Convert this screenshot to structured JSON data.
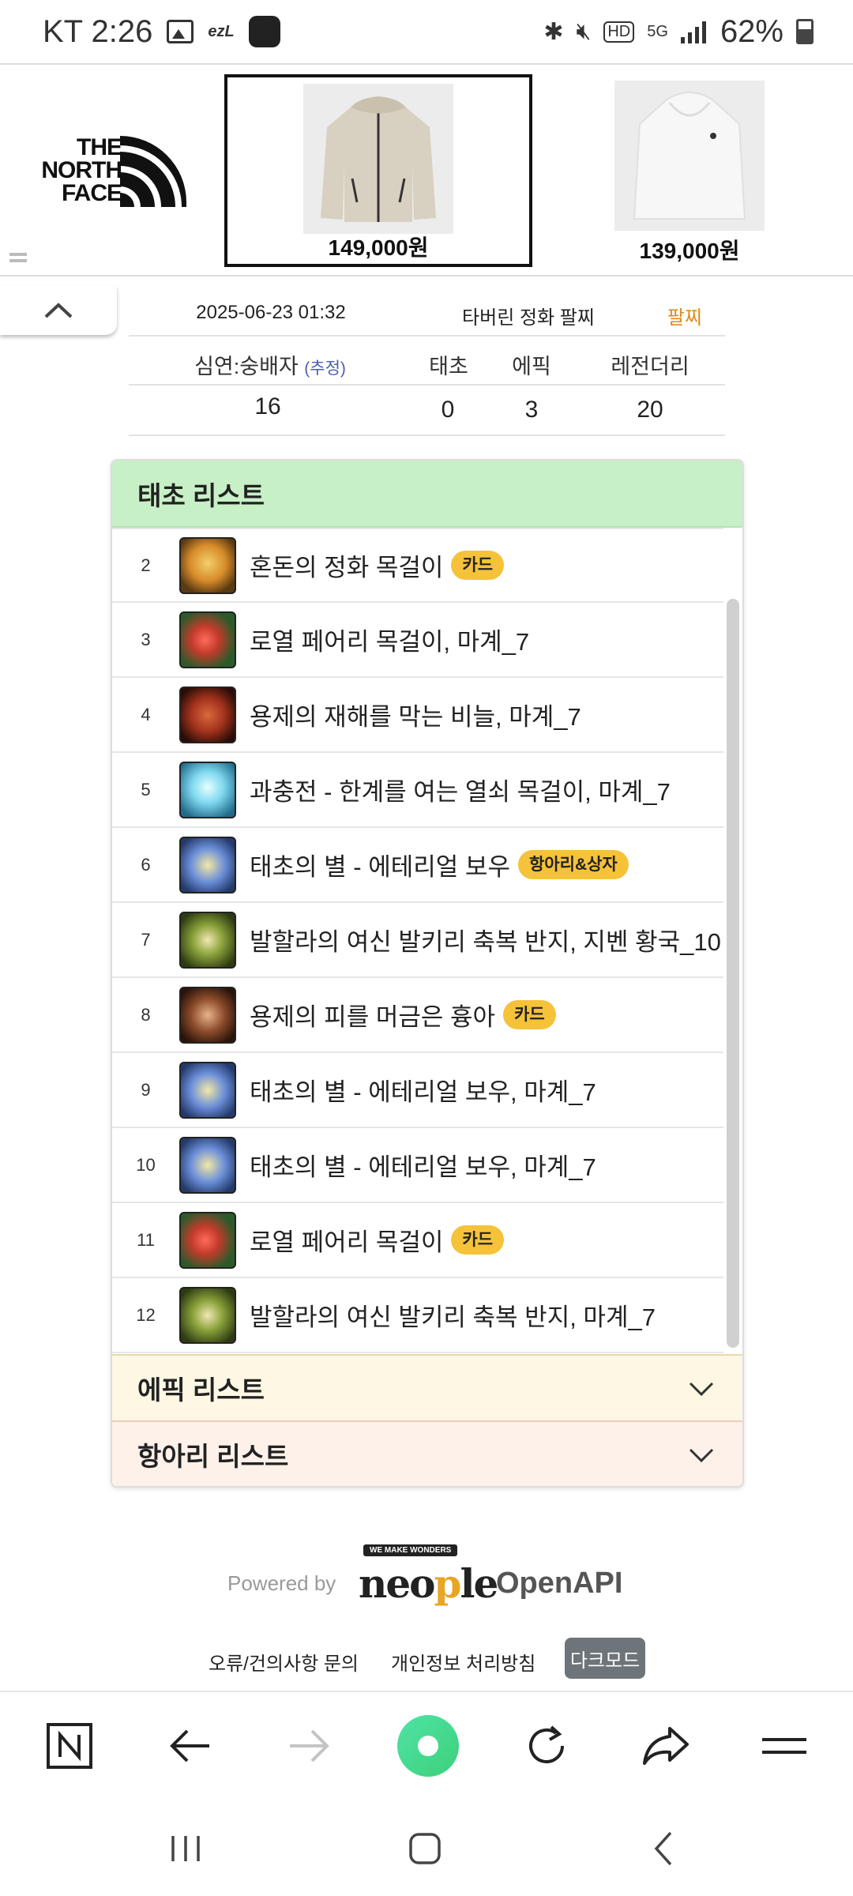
{
  "status_bar": {
    "carrier_time": "KT 2:26",
    "ezl": "ezL",
    "battery": "62%",
    "icons": [
      "image-icon",
      "ezl-icon",
      "app-icon",
      "bluetooth-icon",
      "mute-icon",
      "hd-icon",
      "5g-icon",
      "signal-icon",
      "battery-icon"
    ]
  },
  "ad": {
    "brand_line1": "THE",
    "brand_line2": "NORTH",
    "brand_line3": "FACE",
    "products": [
      {
        "price": "149,000원"
      },
      {
        "price": "139,000원"
      }
    ]
  },
  "stats": {
    "date": "2025-06-23 01:32",
    "title": "타버린 정화 팔찌",
    "status": "팔찌",
    "headers": {
      "ratio_label": "심연:숭배자",
      "estimate": "(추정)",
      "primal": "태초",
      "epic": "에픽",
      "legendary": "레전더리"
    },
    "values": {
      "ratio": "16",
      "primal": "0",
      "epic": "3",
      "legendary": "20"
    }
  },
  "primal_list": {
    "title": "태초 리스트",
    "items": [
      {
        "num": "2",
        "name": "혼돈의 정화 목걸이",
        "badge": "카드"
      },
      {
        "num": "3",
        "name": "로열 페어리 목걸이, 마계_7",
        "badge": ""
      },
      {
        "num": "4",
        "name": "용제의 재해를 막는 비늘, 마계_7",
        "badge": ""
      },
      {
        "num": "5",
        "name": "과충전 - 한계를 여는 열쇠 목걸이, 마계_7",
        "badge": ""
      },
      {
        "num": "6",
        "name": "태초의 별 - 에테리얼 보우",
        "badge": "항아리&상자"
      },
      {
        "num": "7",
        "name": "발할라의 여신 발키리 축복 반지, 지벤 황국_10",
        "badge": ""
      },
      {
        "num": "8",
        "name": "용제의 피를 머금은 흉아",
        "badge": "카드"
      },
      {
        "num": "9",
        "name": "태초의 별 - 에테리얼 보우, 마계_7",
        "badge": ""
      },
      {
        "num": "10",
        "name": "태초의 별 - 에테리얼 보우, 마계_7",
        "badge": ""
      },
      {
        "num": "11",
        "name": "로열 페어리 목걸이",
        "badge": "카드"
      },
      {
        "num": "12",
        "name": "발할라의 여신 발키리 축복 반지, 마계_7",
        "badge": ""
      }
    ]
  },
  "epic_list": {
    "title": "에픽 리스트"
  },
  "accessory_list": {
    "title": "항아리 리스트"
  },
  "footer": {
    "powered_by": "Powered by",
    "brand_tag": "WE MAKE WONDERS",
    "neople_pre": "neo",
    "neople_p": "p",
    "neople_post": "le",
    "openapi": "OpenAPI",
    "link_report": "오류/건의사항 문의",
    "link_privacy": "개인정보 처리방침",
    "dark_mode": "다크모드"
  },
  "colors": {
    "primal_header": "#c8f0c6",
    "epic_header": "#fdf7e4",
    "accessory_header": "#fdf1ea",
    "badge": "#f5c23a",
    "seller": "#e08a1c",
    "estimate": "#4a5db3"
  }
}
